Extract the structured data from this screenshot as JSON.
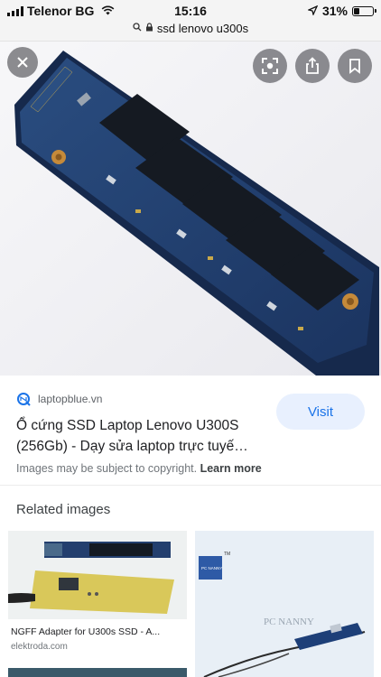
{
  "status": {
    "carrier": "Telenor BG",
    "time": "15:16",
    "battery": "31%",
    "battery_level": 0.31,
    "url": "ssd lenovo u300s"
  },
  "viewer": {
    "icons": [
      "close-icon",
      "lens-icon",
      "share-icon",
      "bookmark-icon"
    ]
  },
  "result": {
    "source": "laptopblue.vn",
    "title": "Ổ cứng SSD Laptop Lenovo U300S (256Gb) - Dạy sửa laptop trực tuyế…",
    "visit_label": "Visit",
    "copyright_text": "Images may be subject to copyright.",
    "learn_more": "Learn more"
  },
  "related": {
    "heading": "Related images",
    "items": [
      {
        "title": "NGFF Adapter for U300s SSD - A...",
        "source": "elektroda.com"
      },
      {
        "watermark": "PC NANNY",
        "logo_text": "PC NANNY",
        "logo_mark": "TM"
      }
    ]
  },
  "colors": {
    "accent": "#1a73e8",
    "visit_bg": "#e8f0fe",
    "board": "#1f3a66"
  }
}
